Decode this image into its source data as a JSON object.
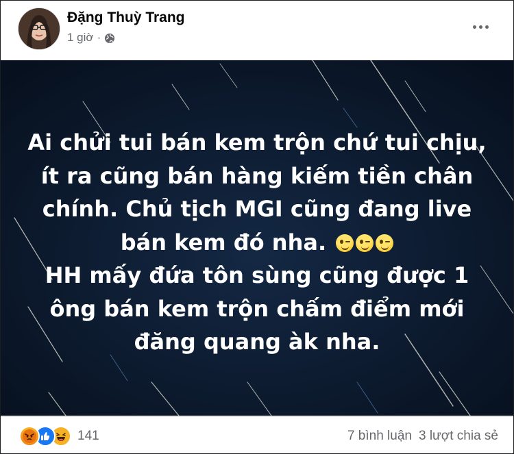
{
  "post": {
    "author": "Đặng Thuỳ Trang",
    "time": "1 giờ",
    "separator": "·",
    "privacy_icon": "globe-icon",
    "more_icon": "more-options-icon",
    "image_text": {
      "line1": "Ai chửi tui bán kem trộn chứ tui chịu,",
      "line2": "ít ra cũng bán hàng kiếm tiền chân",
      "line3": "chính. Chủ tịch MGI cũng đang live",
      "line4": "bán kem đó nha.",
      "line5": "HH mấy đứa tôn sùng cũng được 1",
      "line6": "ông bán kem trộn chấm điểm mới",
      "line7": "đăng quang àk nha."
    },
    "emojis": [
      "wink-face",
      "wink-face",
      "wink-face"
    ]
  },
  "footer": {
    "reactions": [
      "angry-icon",
      "like-icon",
      "haha-icon"
    ],
    "reaction_count": "141",
    "comments": "7 bình luận",
    "shares": "3 lượt chia sẻ"
  },
  "colors": {
    "image_background": "#0d1a2d",
    "text_secondary": "#65676b",
    "like_blue": "#1877f2"
  }
}
